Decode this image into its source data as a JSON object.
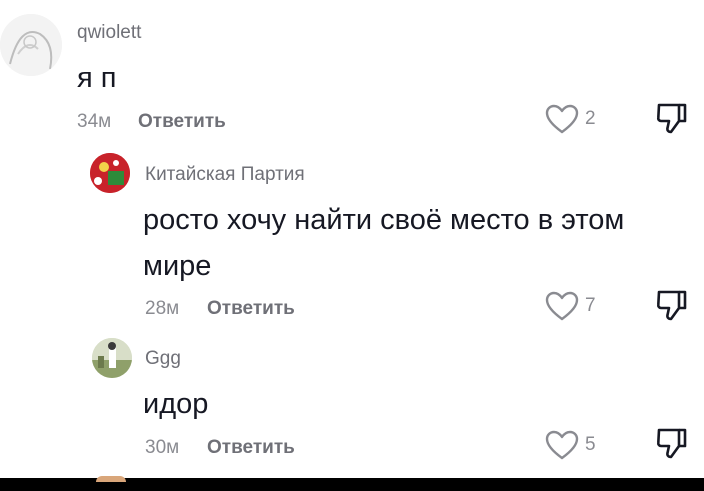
{
  "comments": [
    {
      "username": "qwiolett",
      "text": "я п",
      "time": "34м",
      "reply_label": "Ответить",
      "likes": "2",
      "avatar_icon": "sketch-avatar-icon"
    },
    {
      "username": "Китайская Партия",
      "text_line1": "росто хочу найти своё место в этом",
      "text_line2": "мире",
      "time": "28м",
      "reply_label": "Ответить",
      "likes": "7",
      "avatar_icon": "red-flag-avatar-icon"
    },
    {
      "username": "Ggg",
      "text": "идор",
      "time": "30м",
      "reply_label": "Ответить",
      "likes": "5",
      "avatar_icon": "landscape-avatar-icon"
    }
  ],
  "icons": {
    "like": "heart-outline-icon",
    "dislike": "thumbs-down-icon"
  },
  "colors": {
    "text": "#161823",
    "muted": "#8a8b91",
    "username": "#6f7077"
  }
}
